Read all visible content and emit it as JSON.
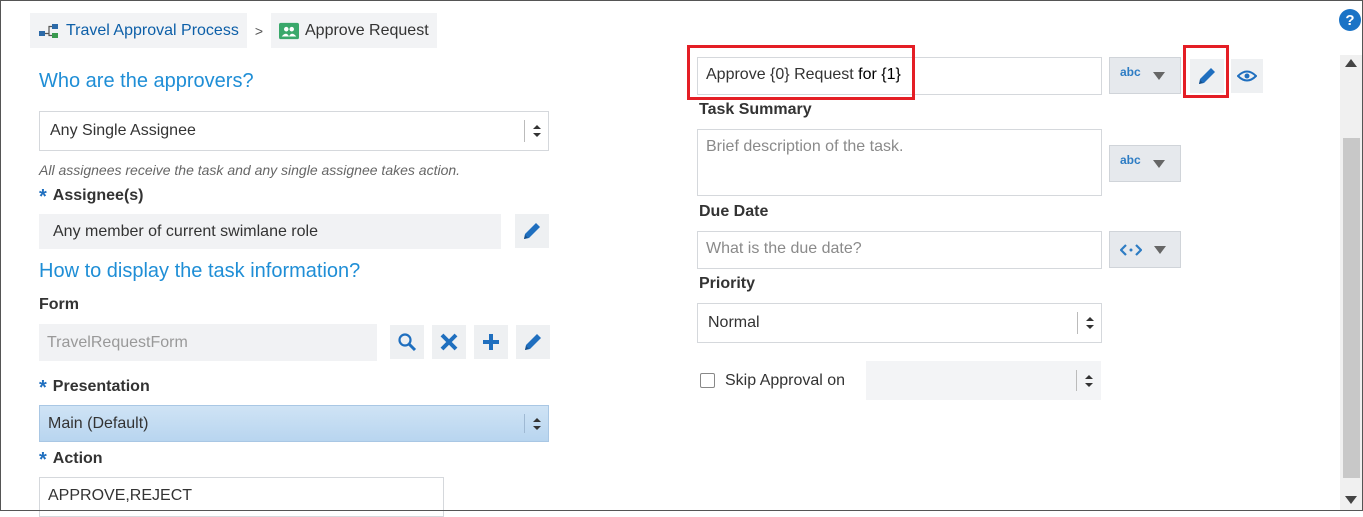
{
  "breadcrumb": {
    "parent": "Travel Approval Process",
    "separator": ">",
    "current": "Approve Request"
  },
  "approvers": {
    "title": "Who are the approvers?",
    "type_value": "Any Single Assignee",
    "hint": "All assignees receive the task and any single assignee takes action.",
    "assignee_label": "Assignee(s)",
    "assignee_value": "Any member of current swimlane role"
  },
  "display": {
    "title": "How to display the task information?",
    "form_label": "Form",
    "form_value": "TravelRequestForm",
    "presentation_label": "Presentation",
    "presentation_value": "Main (Default)",
    "action_label": "Action",
    "action_value": "APPROVE,REJECT"
  },
  "task": {
    "title_part1": "Approve",
    "title_part2": "{0}",
    "title_part3": "Request",
    "title_part4": "for {1}",
    "summary_label": "Task Summary",
    "summary_placeholder": "Brief description of the task.",
    "due_label": "Due Date",
    "due_placeholder": "What is the due date?",
    "priority_label": "Priority",
    "priority_value": "Normal",
    "skip_label": "Skip Approval on",
    "skip_checked": false,
    "type_abc": "abc"
  },
  "help": {
    "label": "?"
  },
  "colors": {
    "accent": "#1f8ed6",
    "icon_blue": "#1f6fbf",
    "highlight_red": "#e41e25"
  }
}
